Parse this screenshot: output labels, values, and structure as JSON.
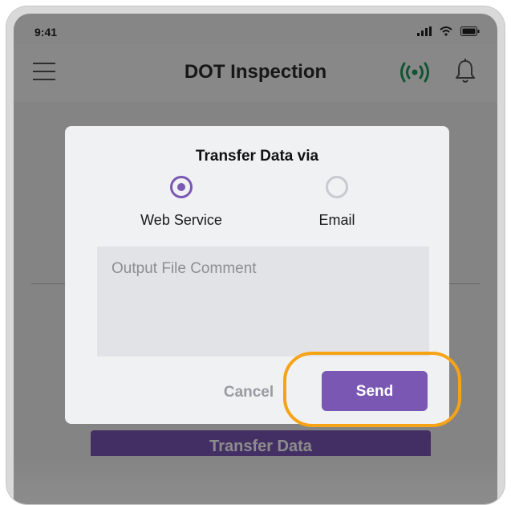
{
  "status_bar": {
    "time": "9:41",
    "icons": [
      "signal-icon",
      "wifi-icon",
      "battery-icon"
    ]
  },
  "app_bar": {
    "title": "DOT Inspection",
    "icons": [
      "menu-icon",
      "connection-icon",
      "bell-icon"
    ]
  },
  "background_content": {
    "transfer_button_label": "Transfer Data"
  },
  "dialog": {
    "title": "Transfer Data via",
    "options": [
      {
        "label": "Web Service",
        "selected": true
      },
      {
        "label": "Email",
        "selected": false
      }
    ],
    "comment_placeholder": "Output File Comment",
    "comment_value": "",
    "cancel_label": "Cancel",
    "send_label": "Send"
  },
  "colors": {
    "accent": "#7b57b4",
    "highlight": "#f6a316",
    "connection_green": "#1f9a5b"
  }
}
